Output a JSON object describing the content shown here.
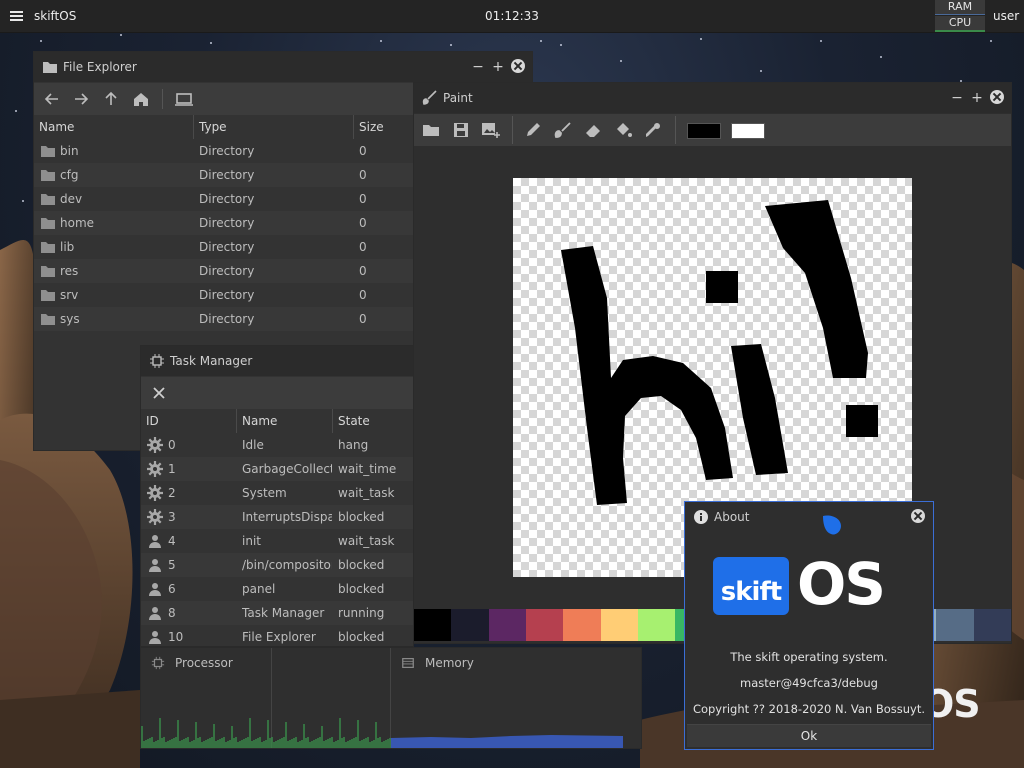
{
  "panel": {
    "app_name": "skiftOS",
    "clock": "01:12:33",
    "ram_label": "RAM",
    "cpu_label": "CPU",
    "user": "user"
  },
  "wallpaper": {
    "brand_text": "OS"
  },
  "file_explorer": {
    "title": "File Explorer",
    "columns": [
      "Name",
      "Type",
      "Size"
    ],
    "rows": [
      {
        "name": "bin",
        "type": "Directory",
        "size": "0"
      },
      {
        "name": "cfg",
        "type": "Directory",
        "size": "0"
      },
      {
        "name": "dev",
        "type": "Directory",
        "size": "0"
      },
      {
        "name": "home",
        "type": "Directory",
        "size": "0"
      },
      {
        "name": "lib",
        "type": "Directory",
        "size": "0"
      },
      {
        "name": "res",
        "type": "Directory",
        "size": "0"
      },
      {
        "name": "srv",
        "type": "Directory",
        "size": "0"
      },
      {
        "name": "sys",
        "type": "Directory",
        "size": "0"
      }
    ]
  },
  "paint": {
    "title": "Paint",
    "primary_color": "#000000",
    "secondary_color": "#ffffff",
    "palette": [
      "#000000",
      "#1b1c2c",
      "#5c2763",
      "#b5404f",
      "#ef7d57",
      "#ffcd75",
      "#a7f070",
      "#38b764",
      "#257179",
      "#29366f",
      "#3b5dc9",
      "#41a6f6",
      "#73eff7",
      "#94b0c2",
      "#566c86",
      "#333c57"
    ]
  },
  "task_manager": {
    "title": "Task Manager",
    "columns": [
      "ID",
      "Name",
      "State"
    ],
    "rows": [
      {
        "id": "0",
        "name": "Idle",
        "state": "hang",
        "kind": "system"
      },
      {
        "id": "1",
        "name": "GarbageCollector",
        "state": "wait_time",
        "kind": "system"
      },
      {
        "id": "2",
        "name": "System",
        "state": "wait_task",
        "kind": "system"
      },
      {
        "id": "3",
        "name": "InterruptsDispatc",
        "state": "blocked",
        "kind": "system"
      },
      {
        "id": "4",
        "name": "init",
        "state": "wait_task",
        "kind": "user"
      },
      {
        "id": "5",
        "name": "/bin/compositor",
        "state": "blocked",
        "kind": "user"
      },
      {
        "id": "6",
        "name": "panel",
        "state": "blocked",
        "kind": "user"
      },
      {
        "id": "8",
        "name": "Task Manager",
        "state": "running",
        "kind": "user"
      },
      {
        "id": "10",
        "name": "File Explorer",
        "state": "blocked",
        "kind": "user"
      }
    ]
  },
  "graphs": {
    "processor_label": "Processor",
    "memory_label": "Memory",
    "processor_color": "#3a8a4a",
    "memory_color": "#3a5ec9"
  },
  "about": {
    "title": "About",
    "logo_left": "skift",
    "logo_right": "OS",
    "tagline": "The skift operating system.",
    "version": "master@49cfca3/debug",
    "copyright": "Copyright ?? 2018-2020 N. Van Bossuyt.",
    "ok_label": "Ok",
    "accent": "#1f6fe8"
  }
}
